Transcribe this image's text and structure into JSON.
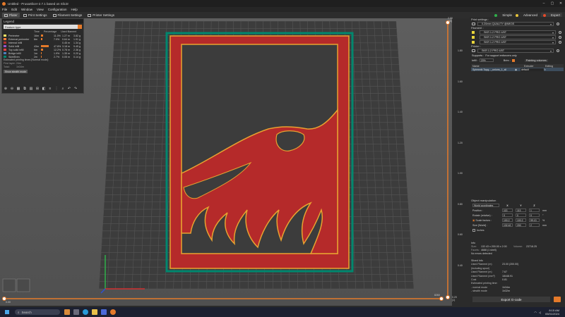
{
  "title": "Untitled - PrusaSlicer-2.7.1 based on Slic3r",
  "menu": [
    "File",
    "Edit",
    "Window",
    "View",
    "Configuration",
    "Help"
  ],
  "tabs": [
    "Plater",
    "Print Settings",
    "Filament Settings",
    "Printer Settings"
  ],
  "modes": {
    "simple": "Simple",
    "advanced": "Advanced",
    "expert": "Expert"
  },
  "legend": {
    "title": "Legend",
    "view_type": "Feature type",
    "cols": [
      "Time",
      "Percentage",
      "Used filament"
    ],
    "rows": [
      {
        "name": "Perimeter",
        "time": "16m",
        "pct": "11.0%",
        "len": "1.27 m",
        "g": "3.82 g",
        "color": "#ffe666",
        "pctval": 0.11
      },
      {
        "name": "External perimeter",
        "time": "8m",
        "pct": "7.9%",
        "len": "0.64 m",
        "g": "1.91 g",
        "color": "#ff7d38",
        "pctval": 0.079
      },
      {
        "name": "Internal infill",
        "time": "",
        "pct": "",
        "len": "0.45 m",
        "g": "1.34 g",
        "color": "#b03029",
        "pctval": 0
      },
      {
        "name": "Solid infill",
        "time": "43m",
        "pct": "47.8%",
        "len": "3.18 m",
        "g": "9.45 g",
        "color": "#9654cc",
        "pctval": 0.478
      },
      {
        "name": "Top solid infill",
        "time": "6m",
        "pct": "12.2%",
        "len": "0.78 m",
        "g": "2.36 g",
        "color": "#f04040",
        "pctval": 0.122
      },
      {
        "name": "Bridge infill",
        "time": "1m",
        "pct": "1.9%",
        "len": "1.35 m",
        "g": "0.20 g",
        "color": "#4d80ba",
        "pctval": 0.019
      },
      {
        "name": "Skirt/Brim",
        "time": "2m",
        "pct": "2.7%",
        "len": "0.05 m",
        "g": "0.14 g",
        "color": "#00876e",
        "pctval": 0.027
      }
    ],
    "est_label": "Estimated printing times [Normal mode]:",
    "first_layer_label": "First layer:",
    "first_layer": "24m",
    "total_label": "Total:",
    "total": "1h34m",
    "stealth": "Show stealth mode"
  },
  "right": {
    "print_settings_label": "Print settings :",
    "print_profile": "0.20mm QUALITY @MK3S",
    "filament_label": "Filament :",
    "filaments": [
      "SKR 1.2 PRO 4/5T",
      "SKR 1.2 PRO 4/5T",
      "SKR 1.2 PRO 4/5T"
    ],
    "printer_label": "Printer :",
    "printer": "SKR 1.2 PRO 4/5T",
    "supports_label": "Supports :",
    "supports": "For support enforcers only",
    "infill_label": "Infill :",
    "infill": "20%",
    "brim_label": "Brim :",
    "painting": "Painting volumes",
    "objhdr": {
      "name": "Name",
      "extruder": "Extruder",
      "editing": "Editing"
    },
    "object": {
      "name": "Spiewnik Topg..._unions_1_sli",
      "extruder": "default"
    }
  },
  "manip": {
    "title": "Object manipulation",
    "coord": "World coordinates",
    "x": "X",
    "y": "Y",
    "z": "Z",
    "pos_label": "Position :",
    "pos": [
      "113",
      "113",
      "1"
    ],
    "pos_unit": "mm",
    "rot_label": "Rotate (relative) :",
    "rot": [
      "0",
      "0",
      "0"
    ],
    "rot_unit": "°",
    "scale_label": "Scale factors :",
    "scale": [
      "100.2",
      "100.2",
      "99.13"
    ],
    "scale_unit": "%",
    "size_label": "Size [World] :",
    "size": [
      "132.42",
      "200",
      "2"
    ],
    "size_unit": "mm",
    "inches": "Inches"
  },
  "info": {
    "title": "Info",
    "size_label": "Size:",
    "size": "132.43 x 200.00 x 2.00",
    "volume_label": "Volume:",
    "volume": "23718.25",
    "facets_label": "Facets:",
    "facets": "4688 (1 shell)",
    "errors": "No errors detected"
  },
  "sliced": {
    "title": "Sliced Info",
    "rows": [
      {
        "k": "Used Filament (m)",
        "v": "23.00 (200.00)"
      },
      {
        "k": "   (including spool)",
        "v": ""
      },
      {
        "k": "Used Filament (m)",
        "v": "7.67"
      },
      {
        "k": "Used Filament (mm³)",
        "v": "18448.91"
      },
      {
        "k": "Cost",
        "v": "0.81"
      },
      {
        "k": "Estimated printing time:",
        "v": ""
      },
      {
        "k": "  - normal mode",
        "v": "1h34m"
      },
      {
        "k": "  - stealth mode",
        "v": "1h32m"
      }
    ]
  },
  "export": "Export G-code",
  "taskbar": {
    "search": "Search",
    "time": "8:15 AM",
    "date": "05/01/2024"
  },
  "slider": {
    "top": "2.00",
    "top_layer": "(10)",
    "bottom": "0.20",
    "bottom_layer": "(1)",
    "hmin": "0.00",
    "hmax": "8260",
    "ticks": [
      "1.80",
      "1.60",
      "1.40",
      "1.20",
      "1.00",
      "0.80",
      "0.60",
      "0.40"
    ]
  }
}
